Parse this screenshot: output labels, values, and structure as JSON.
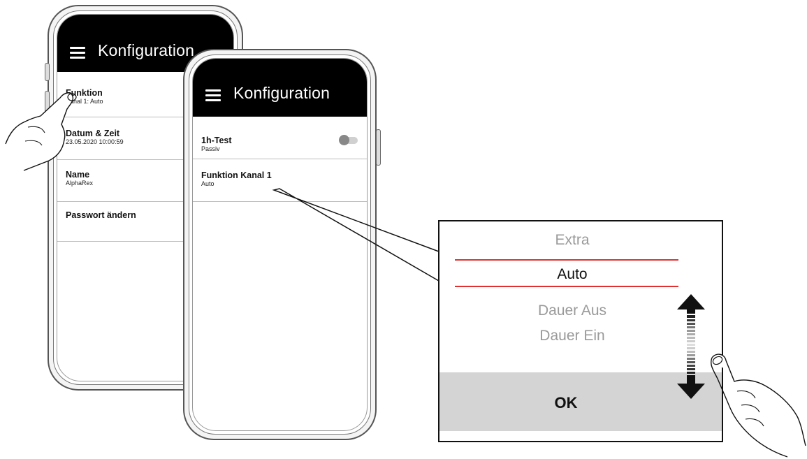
{
  "screen1": {
    "title": "Konfiguration",
    "items": [
      {
        "label": "Funktion",
        "sub": "Kanal 1: Auto"
      },
      {
        "label": "Datum & Zeit",
        "sub": "23.05.2020 10:00:59"
      },
      {
        "label": "Name",
        "sub": "AlphaRex"
      },
      {
        "label": "Passwort ändern",
        "sub": ""
      }
    ]
  },
  "screen2": {
    "title": "Konfiguration",
    "items": [
      {
        "label": "1h-Test",
        "sub": "Passiv",
        "toggle": false
      },
      {
        "label": "Funktion Kanal 1",
        "sub": "Auto"
      }
    ]
  },
  "picker": {
    "options": [
      "Extra",
      "Auto",
      "Dauer Aus",
      "Dauer Ein"
    ],
    "selected": "Auto",
    "ok_label": "OK"
  },
  "icons": [
    "menu-icon",
    "toggle-switch",
    "scroll-arrows-icon",
    "hand-pointer-icon"
  ],
  "colors": {
    "appbar": "#000000",
    "selection_line": "#e03030",
    "ok_bar": "#d4d4d4"
  }
}
